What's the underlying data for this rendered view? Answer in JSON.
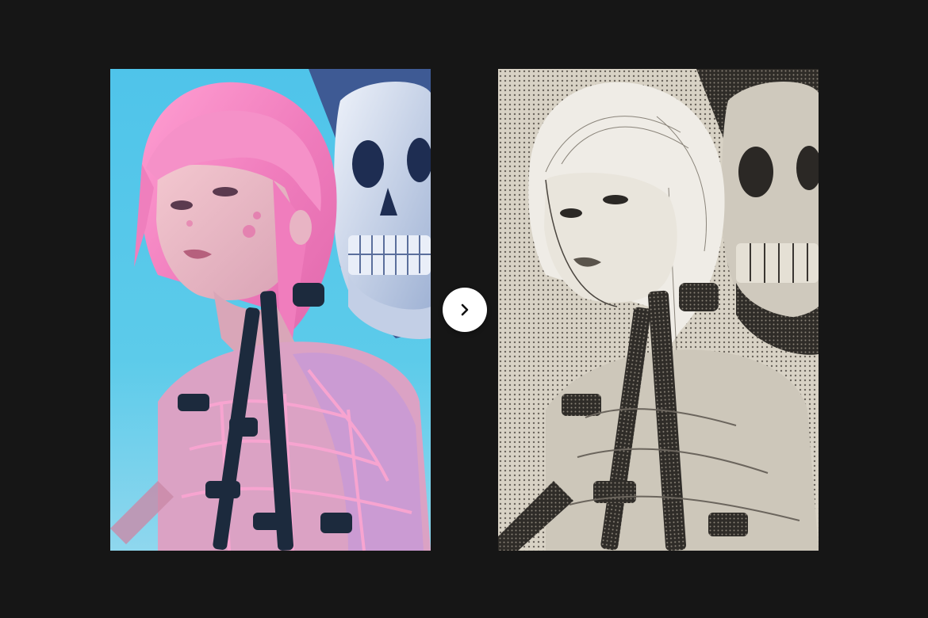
{
  "comparison": {
    "before": {
      "kind": "illustration",
      "style": "full color",
      "colors": {
        "background": "#55c8ea",
        "hair": "#f48fc6",
        "skull": "#dfe6f3",
        "straps": "#1c2a3d",
        "mesh": "#f6a8d3"
      }
    },
    "after": {
      "kind": "illustration",
      "style": "halftone sketch",
      "colors": {
        "paper": "#d9d4c8",
        "ink": "#2b2825"
      }
    },
    "toggle": {
      "icon": "chevron-right-icon",
      "color": "#ffffff",
      "glyph_color": "#111111"
    }
  },
  "page": {
    "background": "#161616"
  }
}
